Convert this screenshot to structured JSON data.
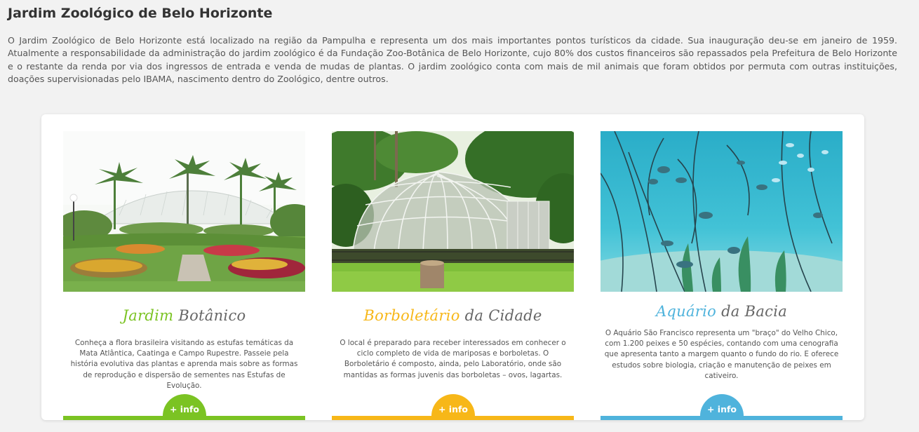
{
  "page": {
    "title": "Jardim Zoológico de Belo Horizonte",
    "intro": "O Jardim Zoológico de Belo Horizonte está localizado na região da Pampulha e representa um dos mais importantes pontos turísticos da cidade. Sua inauguração deu-se em janeiro de 1959. Atualmente a responsabilidade da administração do jardim zoológico é da Fundação Zoo-Botânica de Belo Horizonte, cujo 80% dos custos financeiros são repassados pela Prefeitura de Belo Horizonte e o restante da renda por via dos ingressos de entrada e venda de mudas de plantas. O jardim zoológico conta com mais de mil animais que foram obtidos por permuta com outras instituições, doações supervisionadas pelo IBAMA, nascimento dentro do Zoológico, dentre outros."
  },
  "cards": [
    {
      "title_accent": "Jardim",
      "title_rest": " Botânico",
      "description": "Conheça a flora brasileira visitando as estufas temáticas da Mata Atlântica, Caatinga e Campo Rupestre. Passeie pela história evolutiva das plantas e aprenda mais sobre as formas de reprodução e dispersão de sementes nas Estufas de Evolução.",
      "button_label": "+ info",
      "accent_color": "#7bc323"
    },
    {
      "title_accent": "Borboletário",
      "title_rest": " da Cidade",
      "description": "O local é preparado para receber interessados em conhecer o ciclo completo de vida de mariposas e borboletas. O Borboletário é composto, ainda, pelo Laboratório, onde são mantidas as formas juvenis das borboletas – ovos, lagartas.",
      "button_label": "+ info",
      "accent_color": "#f7b718"
    },
    {
      "title_accent": "Aquário",
      "title_rest": " da Bacia",
      "description": "O Aquário São Francisco representa um \"braço\" do Velho Chico, com 1.200 peixes e 50 espécies, contando com uma cenografia que apresenta tanto a margem quanto o fundo do rio. E oferece estudos sobre biologia, criação e manutenção de peixes em cativeiro.",
      "button_label": "+ info",
      "accent_color": "#4fb3dc"
    }
  ]
}
